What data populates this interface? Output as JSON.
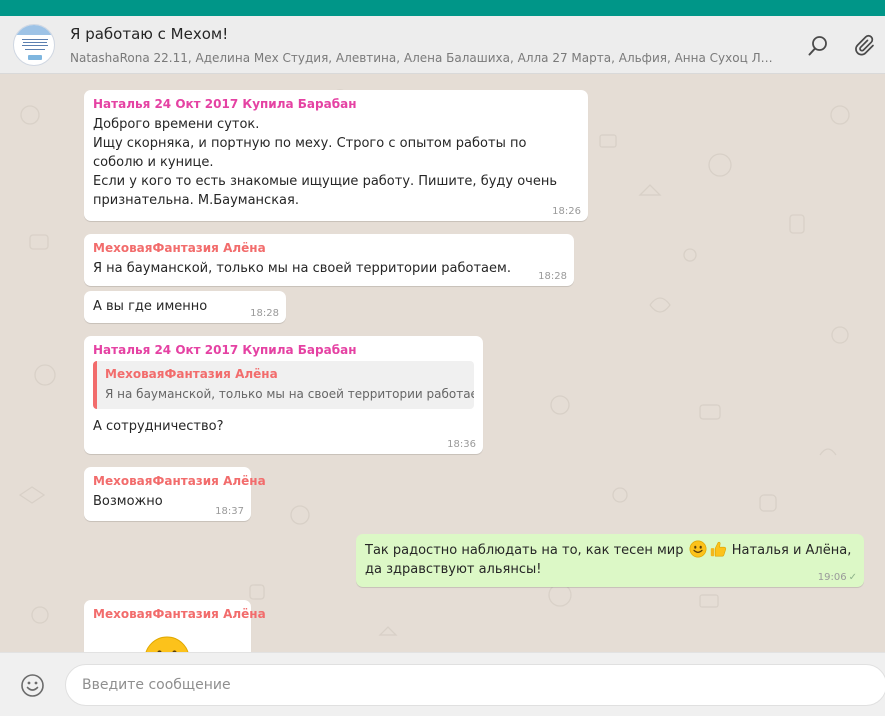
{
  "header": {
    "title": "Я работаю с Мехом!",
    "members": "NatashaRona 22.11, Аделина Мех Студия, Алевтина, Алена Балашиха, Алла 27 Марта, Альфия, Анна Сухоц Лог, Артем…",
    "search_icon": "search-icon",
    "attach_icon": "paperclip-icon"
  },
  "messages": [
    {
      "sender": "Наталья 24 Окт 2017 Купила Барабан",
      "text": "Доброго времени суток.\nИщу скорняка, и портную по меху. Строго с опытом работы по соболю и куницe.\nЕсли у кого то есть знакомые ищущие работу. Пишите, буду очень признательна. М.Бауманская.",
      "time": "18:26"
    },
    {
      "sender": "МеховаяФантазия Алёна",
      "text": "Я на бауманской, только мы на своей территории работаем.",
      "time": "18:28"
    },
    {
      "text": "А вы где именно",
      "time": "18:28"
    },
    {
      "sender": "Наталья 24 Окт 2017 Купила Барабан",
      "quote": {
        "author": "МеховаяФантазия Алёна",
        "text": "Я на бауманской, только мы на своей территории работаем."
      },
      "text": "А сотрудничество?",
      "time": "18:36"
    },
    {
      "sender": "МеховаяФантазия Алёна",
      "text": "Возможно",
      "time": "18:37"
    },
    {
      "text_part1": "Так радостно наблюдать на то, как тесен мир",
      "text_part2": "Наталья и Алёна, да здравствуют альянсы!",
      "emojis": [
        "smiling-face-emoji",
        "thumbs-up-emoji"
      ],
      "time": "19:06",
      "status": "✓"
    },
    {
      "sender": "МеховаяФантазия Алёна",
      "emoji": "smiling-face-emoji"
    }
  ],
  "composer": {
    "placeholder": "Введите сообщение",
    "emoji_icon": "emoji-icon"
  },
  "colors": {
    "topbar": "#009688",
    "background": "#e5ddd5",
    "outgoing_bubble": "#dcf8c6",
    "sender_natalya": "#e542a3",
    "sender_alena": "#f26c6c"
  }
}
